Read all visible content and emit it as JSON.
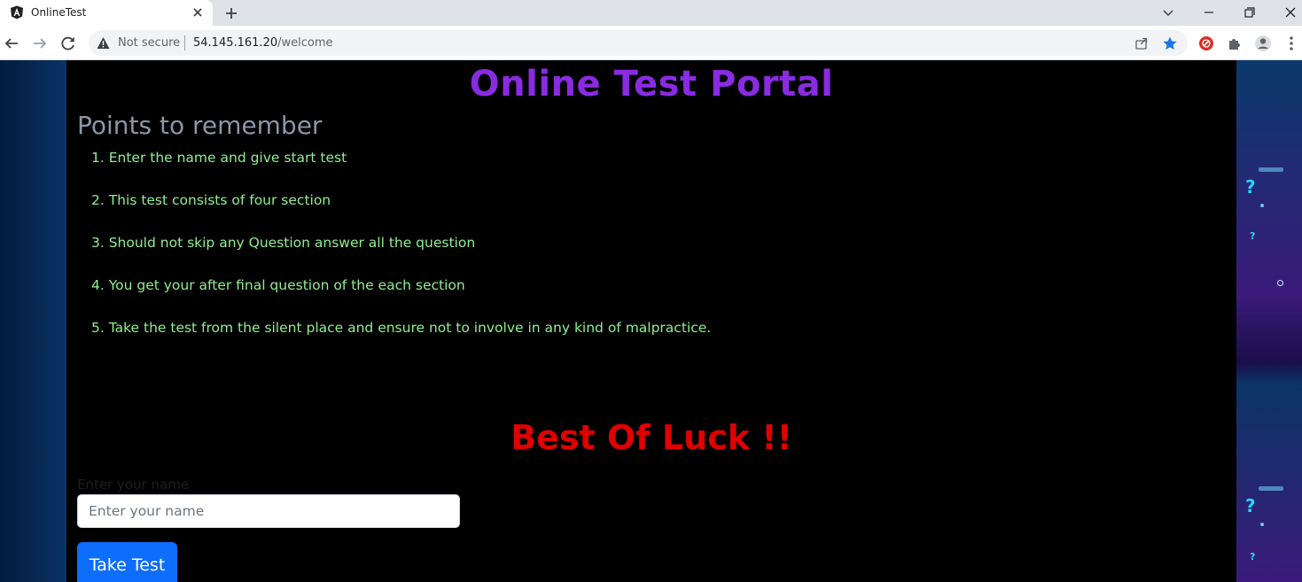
{
  "browser": {
    "tab_title": "OnlineTest",
    "not_secure_label": "Not secure",
    "url_host": "54.145.161.20",
    "url_path": "/welcome"
  },
  "page": {
    "title": "Online Test Portal",
    "points_heading": "Points to remember",
    "rules": [
      "1. Enter the name and give start test",
      "2. This test consists of four section",
      "3. Should not skip any Question answer all the question",
      "4. You get your after final question of the each section",
      "5. Take the test from the silent place and ensure not to involve in any kind of malpractice."
    ],
    "luck_text": "Best Of Luck !!",
    "name_label": "Enter your name",
    "name_placeholder": "Enter your name",
    "name_value": "",
    "take_test_label": "Take Test"
  },
  "colors": {
    "title": "#8a2be2",
    "rules": "#90ee90",
    "luck": "#e00000",
    "button": "#0d6efd"
  },
  "icons": [
    "angular-icon",
    "close-icon",
    "plus-icon",
    "chevron-down-icon",
    "minimize-icon",
    "restore-icon",
    "back-icon",
    "forward-icon",
    "reload-icon",
    "warning-icon",
    "share-icon",
    "star-icon",
    "extension-icon",
    "puzzle-icon",
    "profile-icon",
    "more-icon"
  ]
}
